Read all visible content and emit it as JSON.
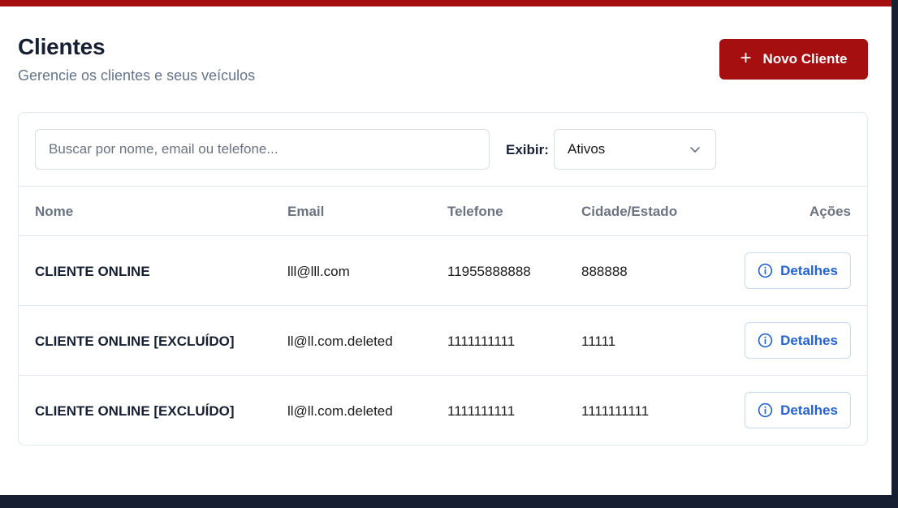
{
  "header": {
    "title": "Clientes",
    "subtitle": "Gerencie os clientes e seus veículos",
    "new_button_label": "Novo Cliente",
    "new_button_icon": "plus-icon"
  },
  "filters": {
    "search_placeholder": "Buscar por nome, email ou telefone...",
    "search_value": "",
    "show_label": "Exibir:",
    "show_selected": "Ativos"
  },
  "table": {
    "columns": {
      "name": "Nome",
      "email": "Email",
      "phone": "Telefone",
      "city": "Cidade/Estado",
      "actions": "Ações"
    },
    "rows": [
      {
        "name": "CLIENTE ONLINE",
        "email": "lll@lll.com",
        "phone": "11955888888",
        "city": "888888",
        "action_label": "Detalhes"
      },
      {
        "name": "CLIENTE ONLINE [EXCLUÍDO]",
        "email": "ll@ll.com.deleted",
        "phone": "1111111111",
        "city": "11111",
        "action_label": "Detalhes"
      },
      {
        "name": "CLIENTE ONLINE [EXCLUÍDO]",
        "email": "ll@ll.com.deleted",
        "phone": "1111111111",
        "city": "1111111111",
        "action_label": "Detalhes"
      }
    ]
  },
  "colors": {
    "brand": "#a50f0f",
    "dark": "#172032",
    "link": "#2563c9"
  }
}
